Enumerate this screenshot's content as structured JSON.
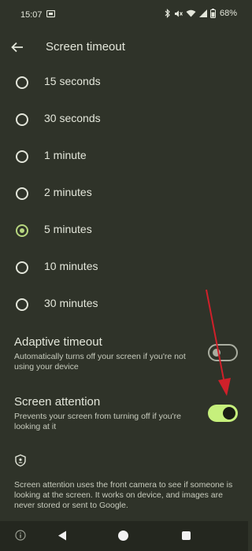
{
  "status_bar": {
    "time": "15:07",
    "battery_text": "68%",
    "icons": [
      "notification-icon",
      "bluetooth-icon",
      "mute-icon",
      "wifi-icon",
      "signal-icon",
      "battery-icon"
    ]
  },
  "app_bar": {
    "title": "Screen timeout",
    "back_icon": "back-arrow-icon"
  },
  "timeout_options": [
    {
      "label": "15 seconds",
      "selected": false
    },
    {
      "label": "30 seconds",
      "selected": false
    },
    {
      "label": "1 minute",
      "selected": false
    },
    {
      "label": "2 minutes",
      "selected": false
    },
    {
      "label": "5 minutes",
      "selected": true
    },
    {
      "label": "10 minutes",
      "selected": false
    },
    {
      "label": "30 minutes",
      "selected": false
    }
  ],
  "adaptive_timeout": {
    "title": "Adaptive timeout",
    "subtitle": "Automatically turns off your screen if you're not using your device",
    "enabled": false
  },
  "screen_attention": {
    "title": "Screen attention",
    "subtitle": "Prevents your screen from turning off if you're looking at it",
    "enabled": true
  },
  "footer": {
    "icon": "shield-icon",
    "note": "Screen attention uses the front camera to see if someone is looking at the screen. It works on device, and images are never stored or sent to Google."
  },
  "nav_bar": {
    "icons": [
      "info-icon",
      "nav-back-icon",
      "nav-home-icon",
      "nav-recents-icon"
    ]
  },
  "colors": {
    "background": "#2f3329",
    "accent": "#b7d67f",
    "toggle_on": "#c6f07c",
    "annotation_arrow": "#d0202a"
  }
}
